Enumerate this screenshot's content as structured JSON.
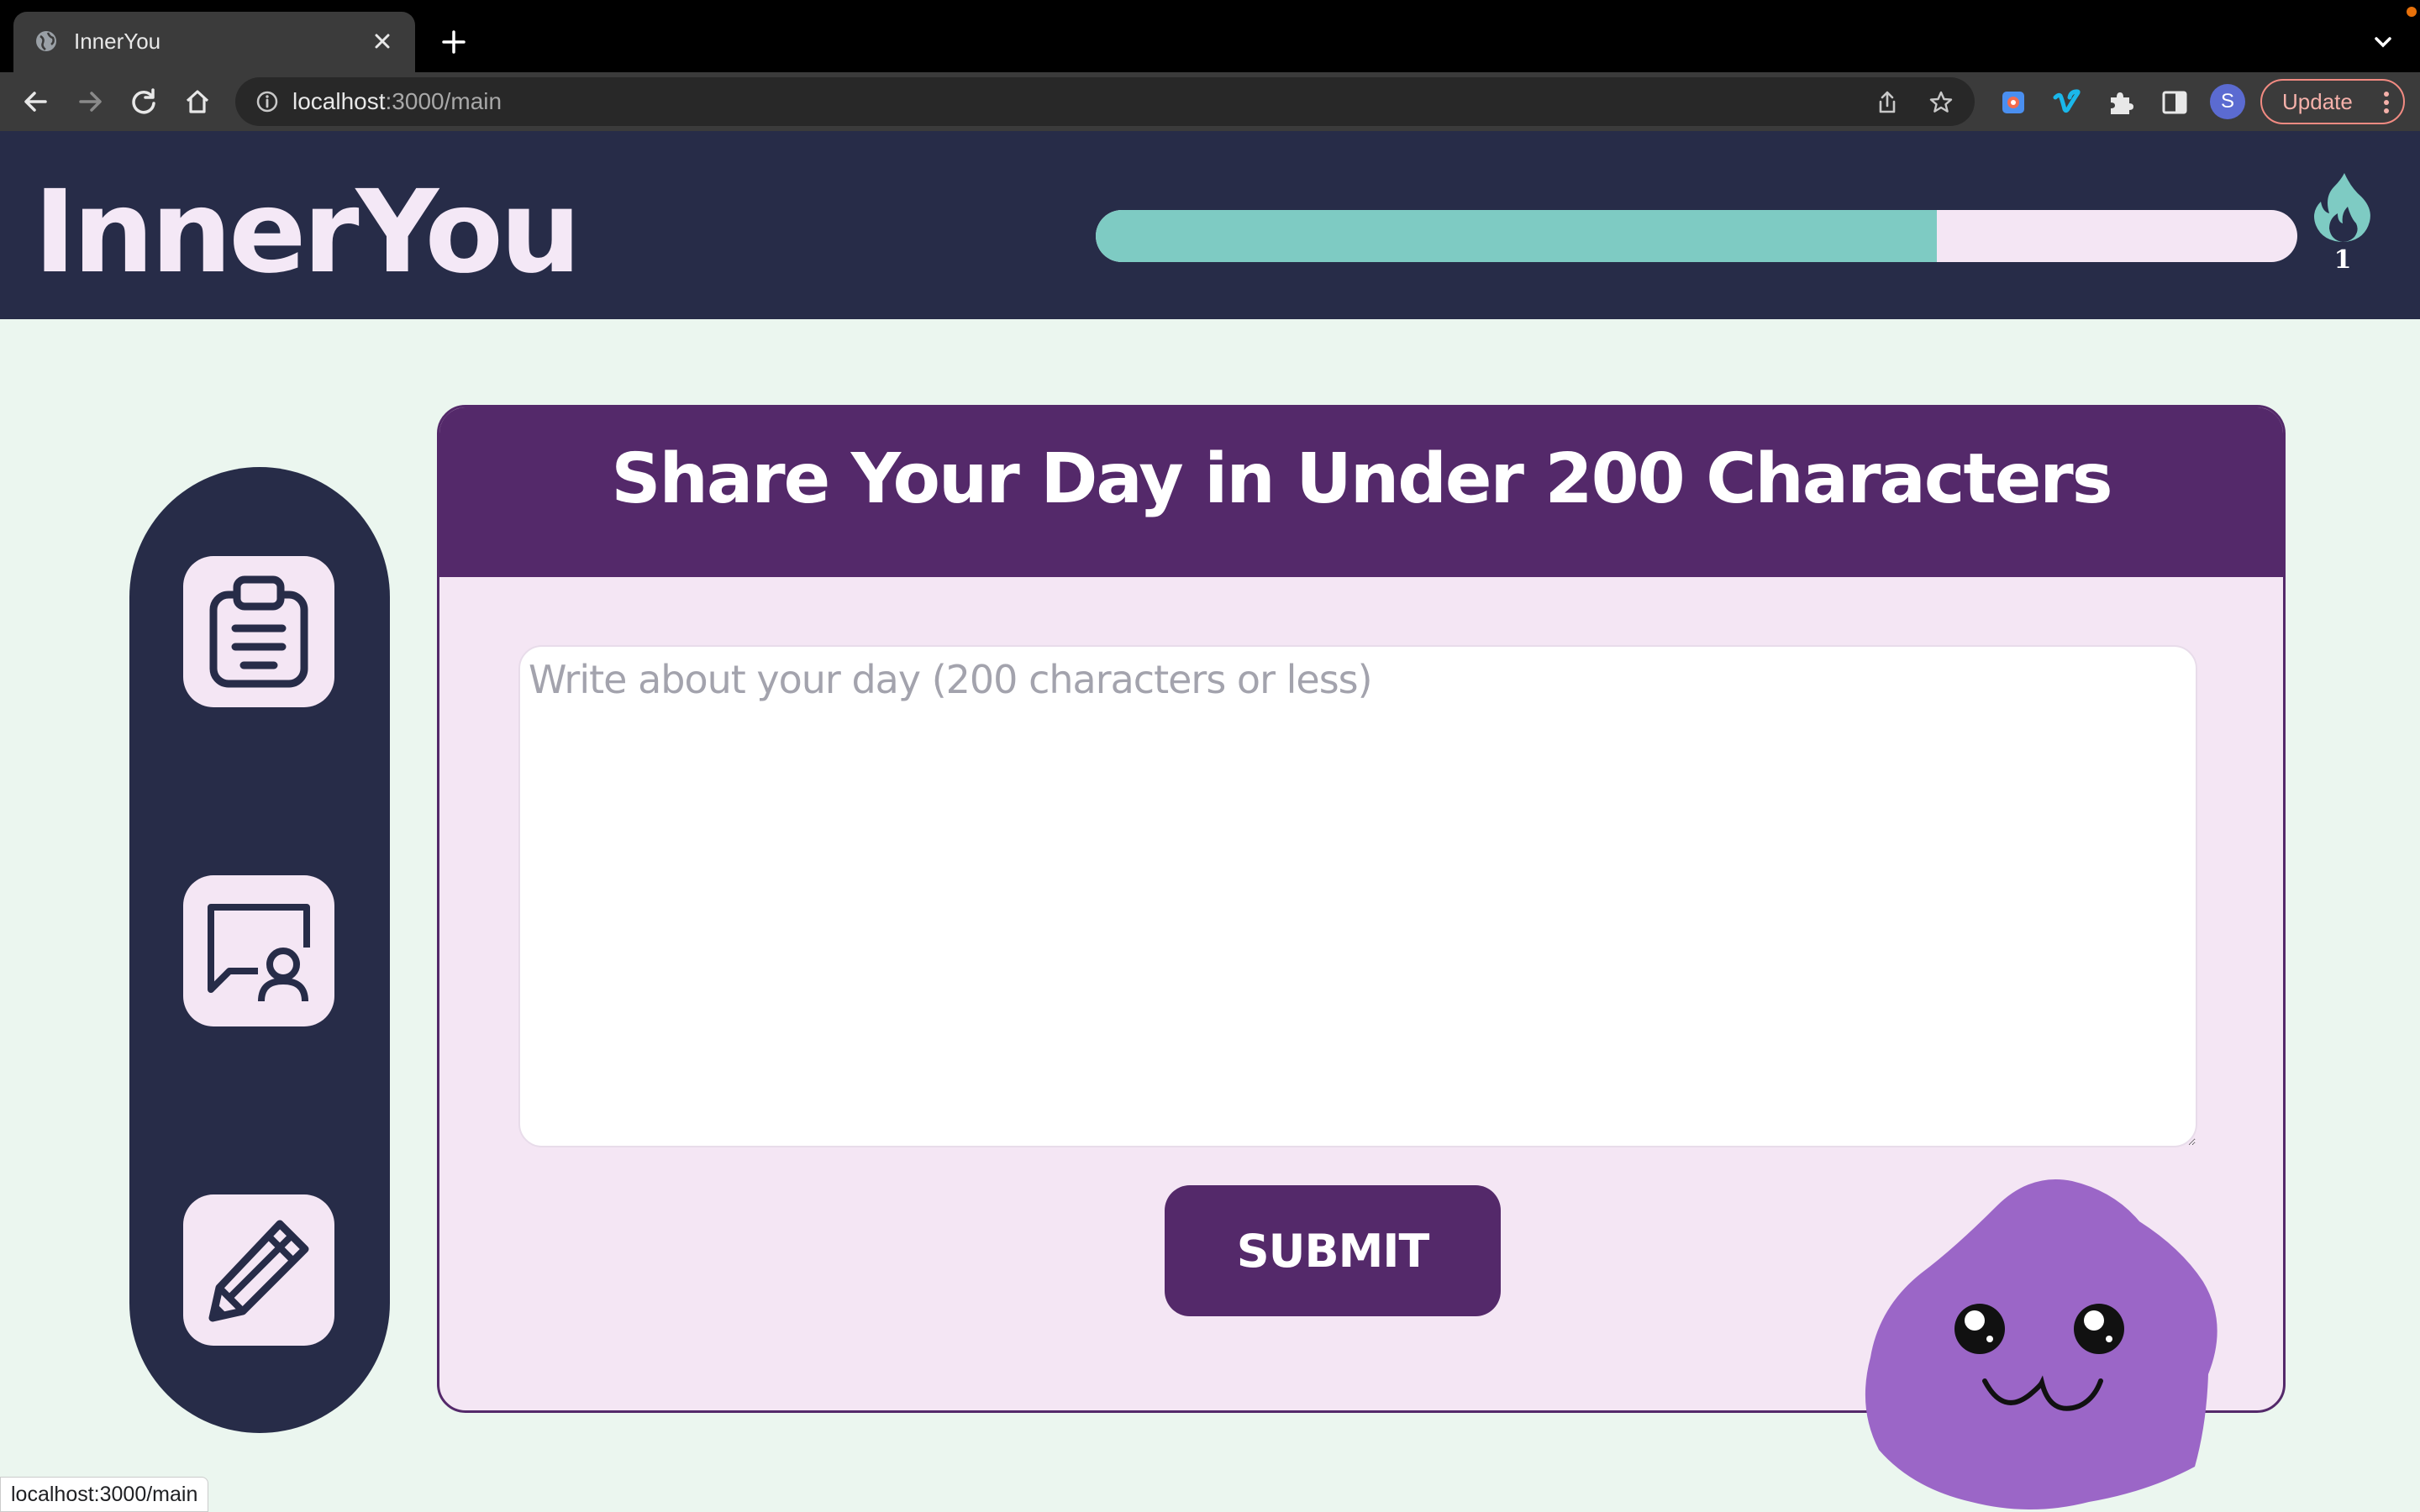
{
  "browser": {
    "tab_title": "InnerYou",
    "url_host": "localhost",
    "url_path": ":3000/main",
    "update_label": "Update",
    "profile_initial": "S",
    "status_url": "localhost:3000/main"
  },
  "header": {
    "logo": "InnerYou",
    "progress_fraction": 0.7,
    "streak_count": "1",
    "colors": {
      "progress_fill": "#7ecbc3",
      "progress_track": "#f4e6f4",
      "flame": "#7ecbc3"
    }
  },
  "sidenav": {
    "items": [
      {
        "name": "clipboard-icon"
      },
      {
        "name": "chat-user-icon"
      },
      {
        "name": "pencil-icon"
      }
    ]
  },
  "card": {
    "title": "Share Your Day in Under 200 Characters",
    "entry_placeholder": "Write about your day (200 characters or less)",
    "entry_value": "",
    "submit_label": "SUBMIT"
  },
  "theme": {
    "background": "#ebf6ef",
    "navy": "#272c48",
    "purple": "#54296a",
    "lavender": "#f4e6f4",
    "mascot": "#9b66c7"
  }
}
